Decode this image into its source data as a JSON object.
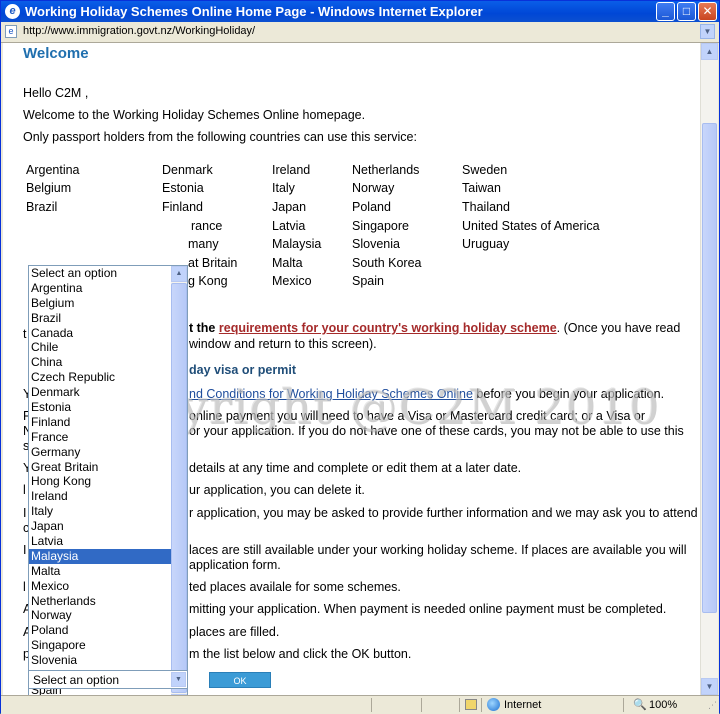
{
  "window": {
    "title": "Working Holiday Schemes Online Home Page - Windows Internet Explorer",
    "minimize": "_",
    "maximize": "□",
    "close": "✕"
  },
  "address": {
    "url": "http://www.immigration.govt.nz/WorkingHoliday/"
  },
  "page": {
    "heading": "Welcome",
    "greeting": "Hello C2M ,",
    "intro": "Welcome to the Working Holiday Schemes Online homepage.",
    "passport_note": "Only passport holders from the following countries can use this service:",
    "countries_col1": [
      "Argentina",
      "Belgium",
      "Brazil"
    ],
    "countries_col2": [
      "Denmark",
      "Estonia",
      "Finland",
      "France",
      "Germany",
      "Great Britain",
      "Hong Kong"
    ],
    "countries_col2_visible": [
      "Denmark",
      "Estonia",
      "Finland",
      "rance",
      "many",
      "at Britain",
      "g Kong"
    ],
    "countries_col3": [
      "Ireland",
      "Italy",
      "Japan",
      "Latvia",
      "Malaysia",
      "Malta",
      "Mexico"
    ],
    "countries_col4": [
      "Netherlands",
      "Norway",
      "Poland",
      "Singapore",
      "Slovenia",
      "South Korea",
      "Spain"
    ],
    "countries_col5": [
      "Sweden",
      "Taiwan",
      "Thailand",
      "United States of America",
      "Uruguay"
    ],
    "req_prefix": "t the",
    "req_link": "requirements for your country's working holiday scheme",
    "req_suffix": ". (Once you have read",
    "req_line2": "window and return to this screen).",
    "section_heading": "day visa or permit",
    "terms_link": "nd Conditions for Working Holiday Schemes Online",
    "terms_suffix": " before you begin your application.",
    "payment_line1": "online payment you will need to have a Visa or Mastercard credit card; or a Visa or",
    "payment_line2": "or your application. If you do not have one of these cards, you may not be able to use this",
    "save_line": " details at any time and complete or edit them at a later date.",
    "delete_line": "ur application, you can delete it.",
    "further_line": "r application, you may be asked to provide further information and we may ask you to attend",
    "places_line1": "laces are still available under your working holiday scheme. If places are available you will",
    "places_line2": "application form.",
    "limited_line": "ted places availale for some schemes.",
    "submit_line": "mitting your application. When payment is needed online payment must be completed.",
    "filled_line": " places are filled.",
    "choose_line": "m the list below and click the OK button.",
    "left_fragments": [
      "t",
      "Y",
      "P",
      "N",
      "s",
      "Y",
      "l",
      "I",
      "c",
      "I",
      "l",
      "A",
      "A",
      "p"
    ]
  },
  "listbox": {
    "options": [
      "Select an option",
      "Argentina",
      "Belgium",
      "Brazil",
      "Canada",
      "Chile",
      "China",
      "Czech Republic",
      "Denmark",
      "Estonia",
      "Finland",
      "France",
      "Germany",
      "Great Britain",
      "Hong Kong",
      "Ireland",
      "Italy",
      "Japan",
      "Latvia",
      "Malaysia",
      "Malta",
      "Mexico",
      "Netherlands",
      "Norway",
      "Poland",
      "Singapore",
      "Slovenia",
      "South Korea",
      "Spain",
      "Sweden"
    ],
    "selected": "Malaysia"
  },
  "select": {
    "value": "Select an option"
  },
  "ok_button": {
    "label": "OK"
  },
  "watermark": "Copyright @C2M 2010",
  "status": {
    "zone": "Internet",
    "zoom": "100%"
  },
  "icons": {
    "ie": "internet-explorer-icon",
    "page": "page-icon",
    "globe": "globe-icon",
    "lock": "lock-icon"
  },
  "colors": {
    "titlebar": "#0a5ee8",
    "heading": "#1f6fae",
    "req_link": "#a52a2a",
    "selection": "#316ac5",
    "ok_button": "#3b9bd6"
  }
}
